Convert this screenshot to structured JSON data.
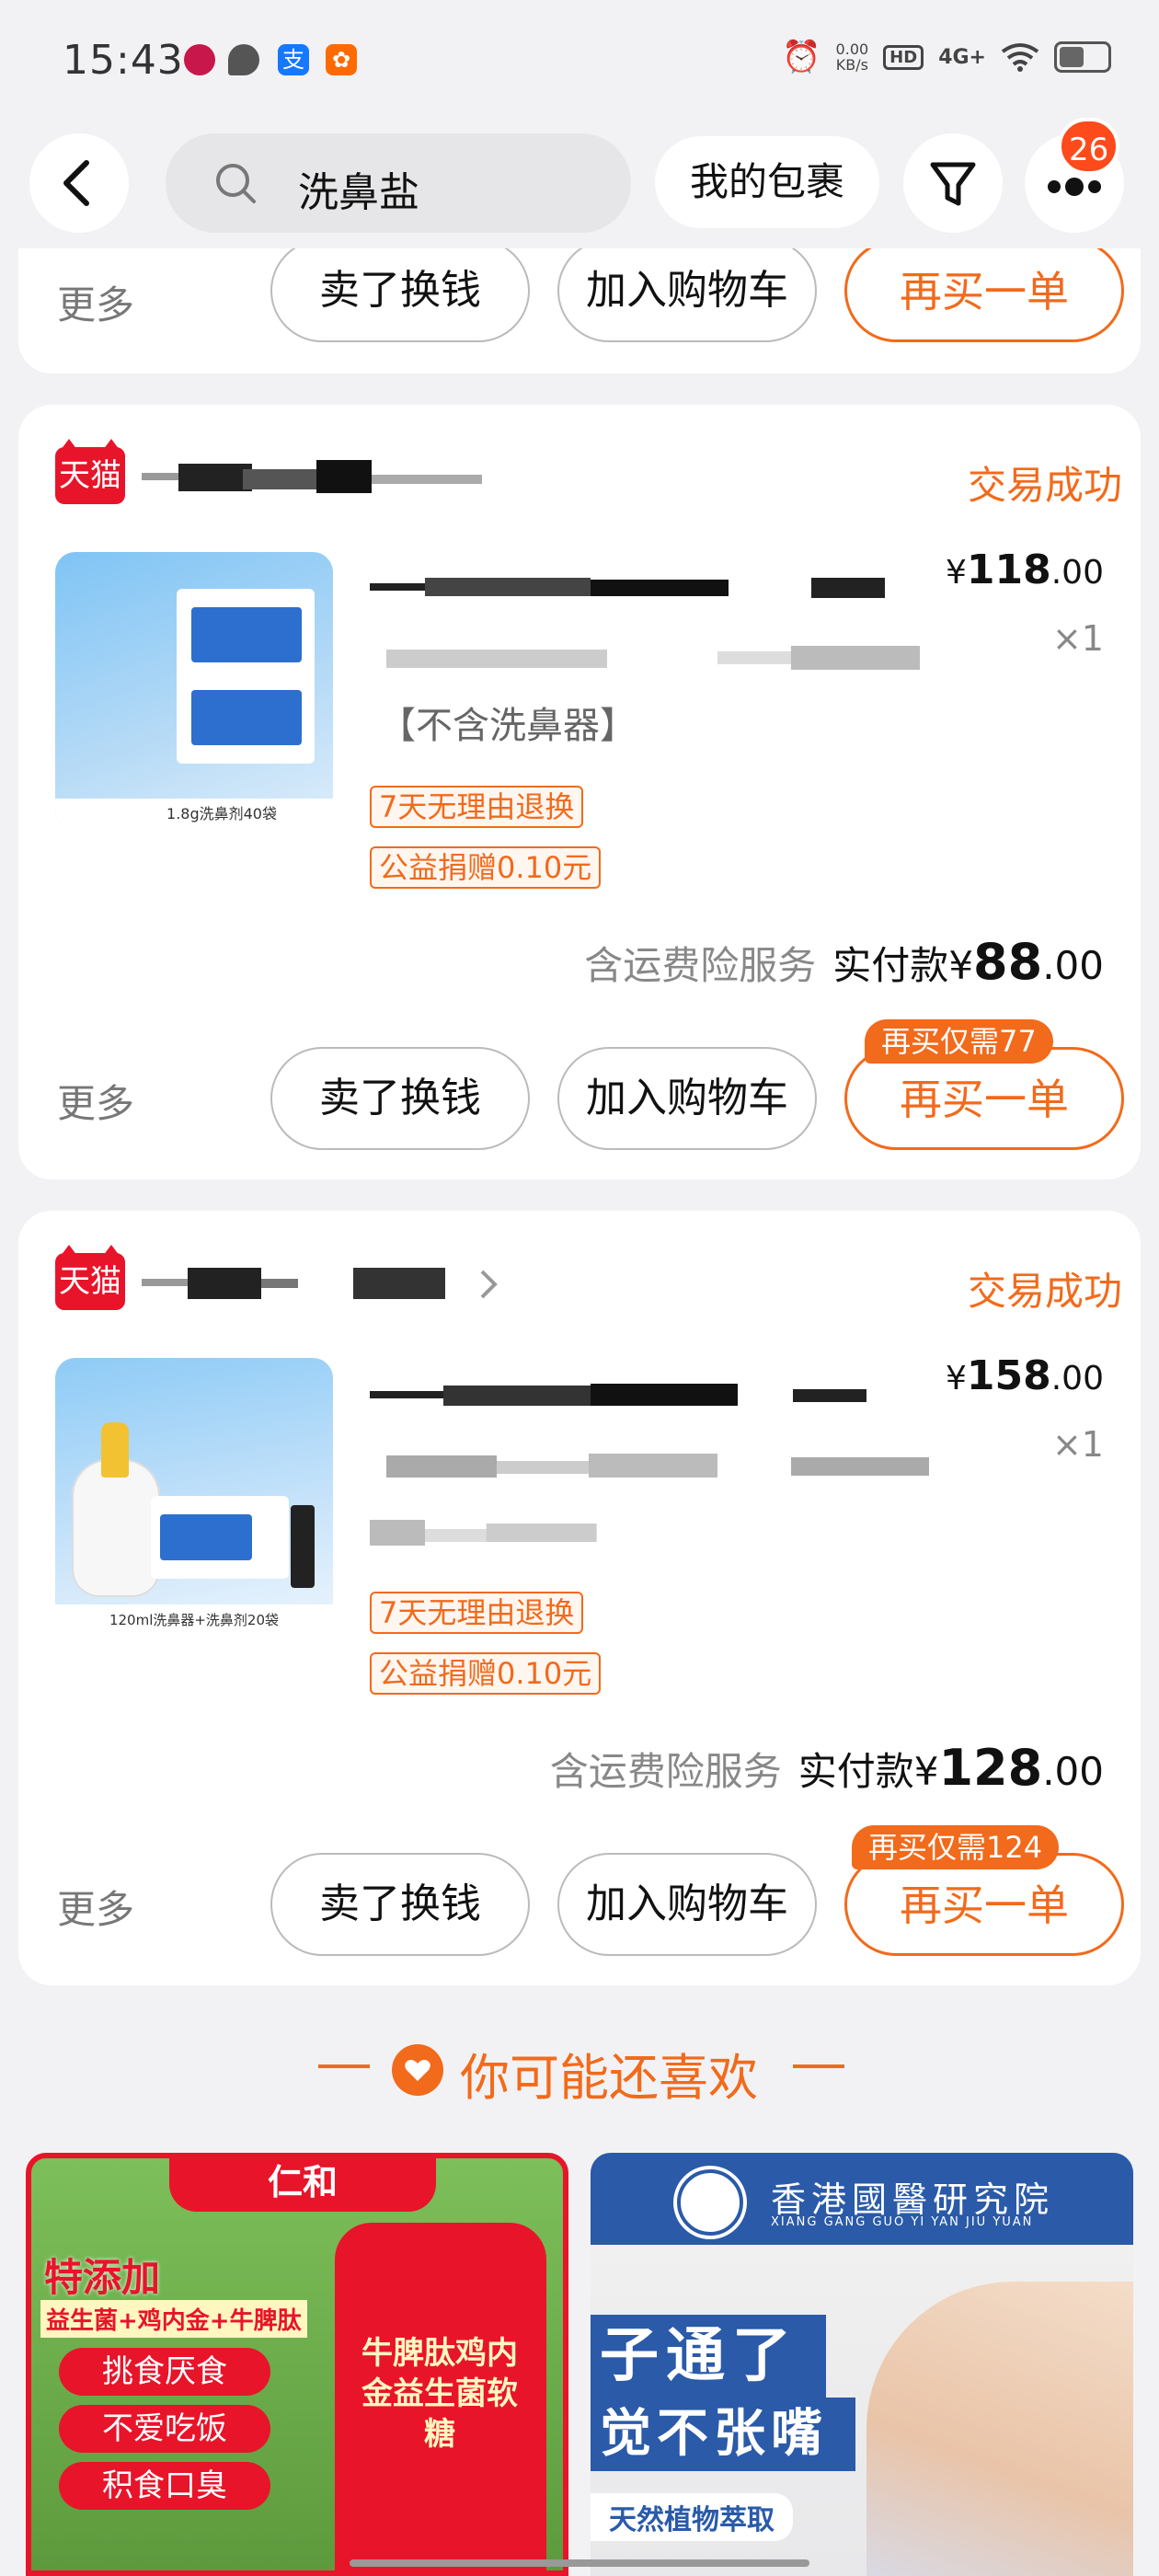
{
  "status_bar": {
    "time": "15:43",
    "speed_value": "0.00",
    "speed_unit": "KB/s",
    "hd": "HD",
    "network": "4G+"
  },
  "header": {
    "search_text": "洗鼻盐",
    "packages_label": "我的包裹",
    "more_badge": "26"
  },
  "orders": [
    {
      "buttons": {
        "more": "更多",
        "sell": "卖了换钱",
        "cart": "加入购物车",
        "rebuy": "再买一单"
      }
    },
    {
      "shop_badge": "天猫",
      "status": "交易成功",
      "price_currency": "¥",
      "price_int": "118",
      "price_dec": ".00",
      "quantity": "×1",
      "spec": "【不含洗鼻器】",
      "tags": [
        "7天无理由退换",
        "公益捐赠0.10元"
      ],
      "service": "含运费险服务",
      "paid_label": "实付款",
      "paid_currency": "¥",
      "paid_int": "88",
      "paid_dec": ".00",
      "rebuy_tag": "再买仅需77",
      "thumb_caption": "1.8g洗鼻剂40袋",
      "buttons": {
        "more": "更多",
        "sell": "卖了换钱",
        "cart": "加入购物车",
        "rebuy": "再买一单"
      }
    },
    {
      "shop_badge": "天猫",
      "status": "交易成功",
      "price_currency": "¥",
      "price_int": "158",
      "price_dec": ".00",
      "quantity": "×1",
      "tags": [
        "7天无理由退换",
        "公益捐赠0.10元"
      ],
      "service": "含运费险服务",
      "paid_label": "实付款",
      "paid_currency": "¥",
      "paid_int": "128",
      "paid_dec": ".00",
      "rebuy_tag": "再买仅需124",
      "thumb_caption": "120ml洗鼻器+洗鼻剂20袋",
      "buttons": {
        "more": "更多",
        "sell": "卖了换钱",
        "cart": "加入购物车",
        "rebuy": "再买一单"
      }
    }
  ],
  "recommend_title": "你可能还喜欢",
  "ads": [
    {
      "brand": "仁和",
      "headline": "特添加",
      "sub": "益生菌+鸡内金+牛脾肽",
      "points": [
        "挑食厌食",
        "不爱吃饭",
        "积食口臭"
      ],
      "jar_label": "牛脾肽鸡内金益生菌软糖"
    },
    {
      "org": "香港國醫研究院",
      "org_en": "XIANG GANG GUO YI YAN JIU YUAN",
      "line1": "子通了",
      "line2": "觉不张嘴",
      "foot": "天然植物萃取"
    }
  ],
  "colors": {
    "accent": "#f26a1b",
    "tmall": "#e8142a",
    "badge": "#ff4a1c"
  }
}
